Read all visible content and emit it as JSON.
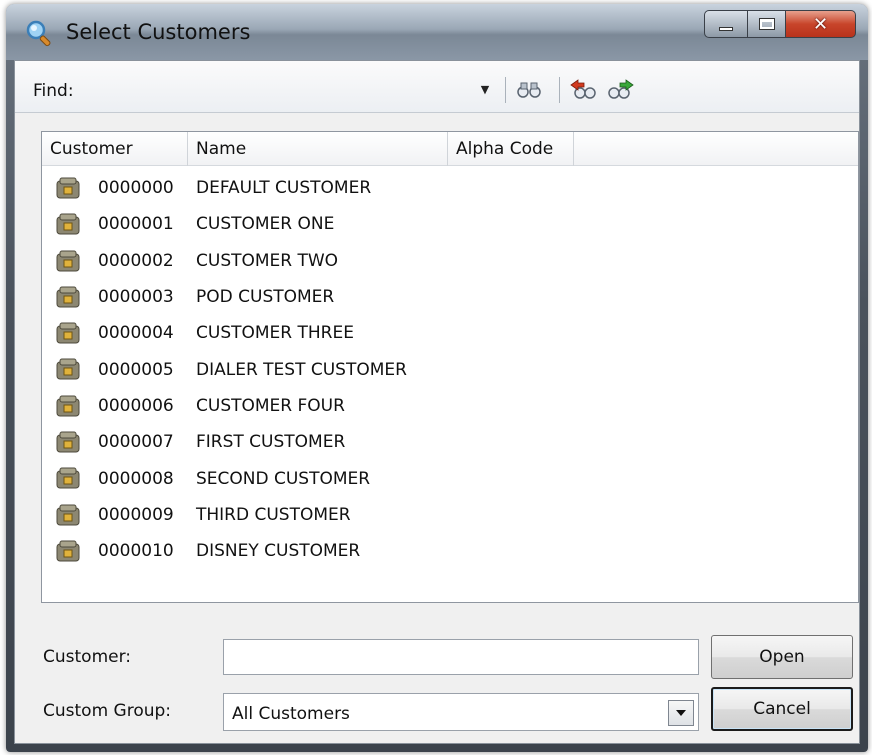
{
  "window": {
    "title": "Select Customers",
    "accent_close": "#c8452b"
  },
  "toolbar": {
    "find_label": "Find:",
    "find_value": "",
    "icons": [
      "find-binoculars-icon",
      "find-previous-icon",
      "find-next-icon"
    ]
  },
  "list": {
    "columns": [
      "Customer",
      "Name",
      "Alpha Code"
    ],
    "rows": [
      {
        "code": "0000000",
        "name": "DEFAULT CUSTOMER"
      },
      {
        "code": "0000001",
        "name": "CUSTOMER ONE"
      },
      {
        "code": "0000002",
        "name": "CUSTOMER TWO"
      },
      {
        "code": "0000003",
        "name": "POD CUSTOMER"
      },
      {
        "code": "0000004",
        "name": "CUSTOMER THREE"
      },
      {
        "code": "0000005",
        "name": "DIALER TEST CUSTOMER"
      },
      {
        "code": "0000006",
        "name": "CUSTOMER FOUR"
      },
      {
        "code": "0000007",
        "name": "FIRST CUSTOMER"
      },
      {
        "code": "0000008",
        "name": "SECOND CUSTOMER"
      },
      {
        "code": "0000009",
        "name": "THIRD CUSTOMER"
      },
      {
        "code": "0000010",
        "name": "DISNEY CUSTOMER"
      }
    ]
  },
  "form": {
    "customer_label": "Customer:",
    "customer_value": "",
    "group_label": "Custom Group:",
    "group_value": "All Customers"
  },
  "buttons": {
    "open": "Open",
    "cancel": "Cancel"
  }
}
